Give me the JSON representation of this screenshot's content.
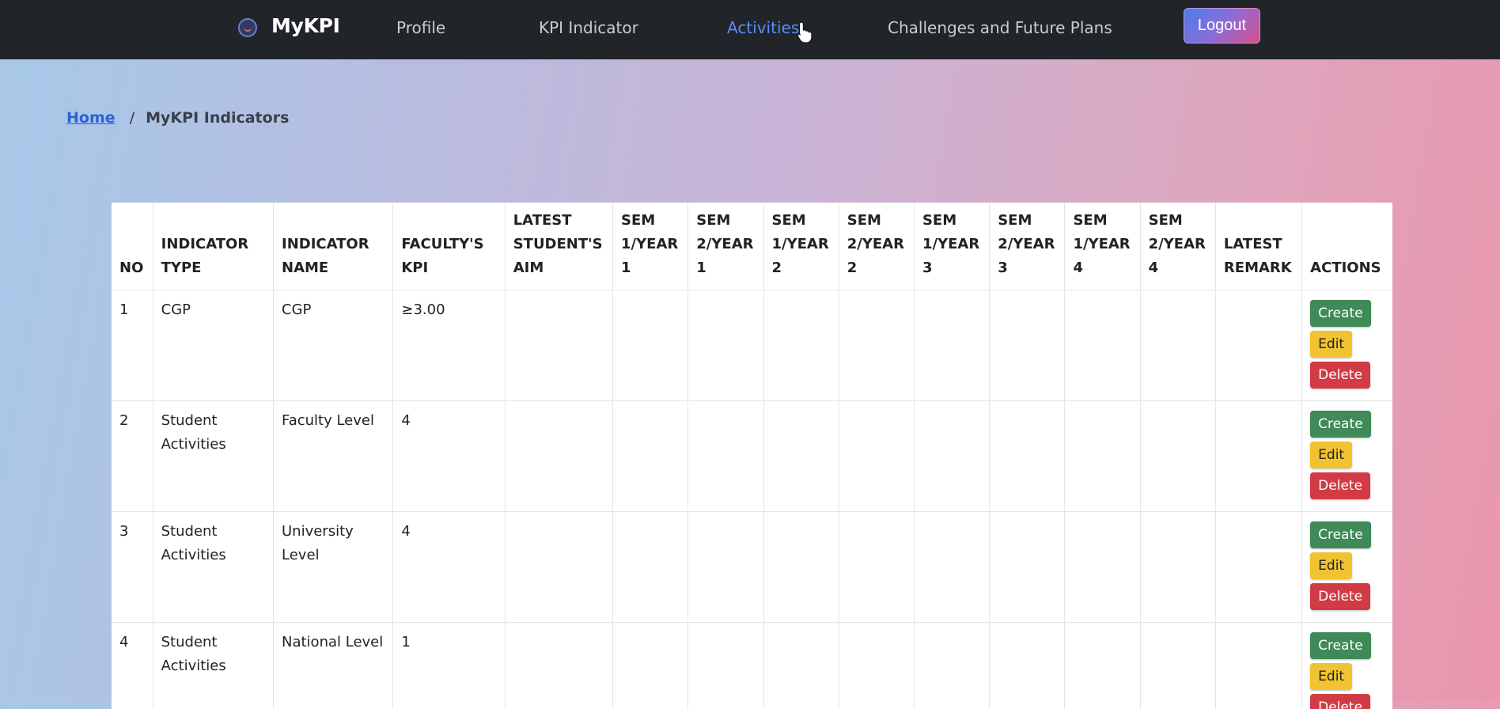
{
  "nav": {
    "brand": "MyKPI",
    "links": [
      "Profile",
      "KPI Indicator",
      "Activities",
      "Challenges and Future Plans"
    ],
    "logout_label": "Logout",
    "active_link": "Activities"
  },
  "breadcrumb": {
    "home": "Home",
    "separator": "/",
    "current": "MyKPI Indicators"
  },
  "table": {
    "headers": [
      "NO",
      "INDICATOR TYPE",
      "INDICATOR NAME",
      "FACULTY'S KPI",
      "LATEST STUDENT'S AIM",
      "SEM 1/YEAR 1",
      "SEM 2/YEAR 1",
      "SEM 1/YEAR 2",
      "SEM 2/YEAR 2",
      "SEM 1/YEAR 3",
      "SEM 2/YEAR 3",
      "SEM 1/YEAR 4",
      "SEM 2/YEAR 4",
      "LATEST REMARK",
      "ACTIONS"
    ],
    "rows": [
      {
        "no": "1",
        "type": "CGP",
        "name": "CGP",
        "kpi": "≥3.00"
      },
      {
        "no": "2",
        "type": "Student Activities",
        "name": "Faculty Level",
        "kpi": "4"
      },
      {
        "no": "3",
        "type": "Student Activities",
        "name": "University Level",
        "kpi": "4"
      },
      {
        "no": "4",
        "type": "Student Activities",
        "name": "National Level",
        "kpi": "1"
      }
    ],
    "actions": {
      "create": "Create",
      "edit": "Edit",
      "delete": "Delete"
    }
  },
  "colors": {
    "navbar": "#212529",
    "active_link": "#5b8cf5",
    "create": "#3f8a58",
    "edit": "#f1c231",
    "delete": "#d23b45"
  },
  "icons": {
    "brand": "brand-logo-icon",
    "cursor": "hand-pointer-icon"
  }
}
